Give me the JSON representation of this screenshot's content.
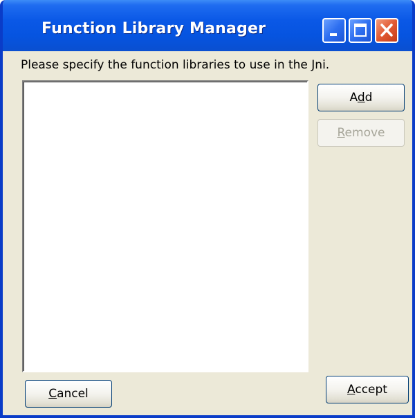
{
  "window": {
    "title": "Function Library Manager"
  },
  "instruction": "Please specify the function libraries to use in the Jni.",
  "list": {
    "items": []
  },
  "buttons": {
    "add": {
      "pre": "A",
      "mnemonic": "d",
      "post": "d"
    },
    "remove": {
      "pre": "",
      "mnemonic": "R",
      "post": "emove"
    },
    "cancel": {
      "pre": "",
      "mnemonic": "C",
      "post": "ancel"
    },
    "accept": {
      "pre": "",
      "mnemonic": "A",
      "post": "ccept"
    }
  },
  "colors": {
    "titlebar": "#0a58e6",
    "dialog_bg": "#ece9d8",
    "close_button": "#e25a33"
  },
  "icons": {
    "minimize": "minimize-icon",
    "maximize": "maximize-icon",
    "close": "close-icon"
  }
}
